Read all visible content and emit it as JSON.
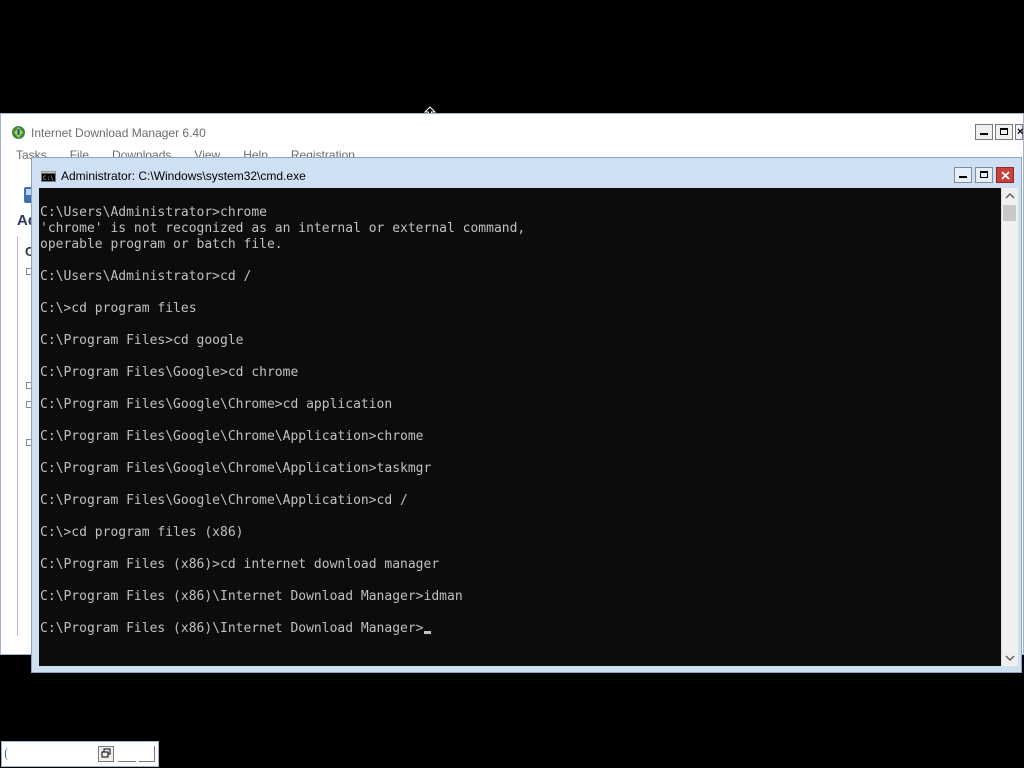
{
  "idm": {
    "title": "Internet Download Manager 6.40",
    "menu": [
      "Tasks",
      "File",
      "Downloads",
      "View",
      "Help",
      "Registration"
    ],
    "left_fragment": "Ad",
    "category_fragment": "C"
  },
  "cmd": {
    "title": "Administrator: C:\\Windows\\system32\\cmd.exe",
    "lines": [
      "C:\\Users\\Administrator>chrome",
      "'chrome' is not recognized as an internal or external command,",
      "operable program or batch file.",
      "",
      "C:\\Users\\Administrator>cd /",
      "",
      "C:\\>cd program files",
      "",
      "C:\\Program Files>cd google",
      "",
      "C:\\Program Files\\Google>cd chrome",
      "",
      "C:\\Program Files\\Google\\Chrome>cd application",
      "",
      "C:\\Program Files\\Google\\Chrome\\Application>chrome",
      "",
      "C:\\Program Files\\Google\\Chrome\\Application>taskmgr",
      "",
      "C:\\Program Files\\Google\\Chrome\\Application>cd /",
      "",
      "C:\\>cd program files (x86)",
      "",
      "C:\\Program Files (x86)>cd internet download manager",
      "",
      "C:\\Program Files (x86)\\Internet Download Manager>idman",
      "",
      "C:\\Program Files (x86)\\Internet Download Manager>"
    ]
  },
  "icons": {
    "idm_logo": "idm-logo-icon",
    "cmd_icon": "cmd-icon",
    "cursor": "resize-vertical-cursor-icon"
  },
  "colors": {
    "console_bg": "#0c0c0c",
    "console_text": "#c0c0c0",
    "close_button": "#c9403a"
  }
}
